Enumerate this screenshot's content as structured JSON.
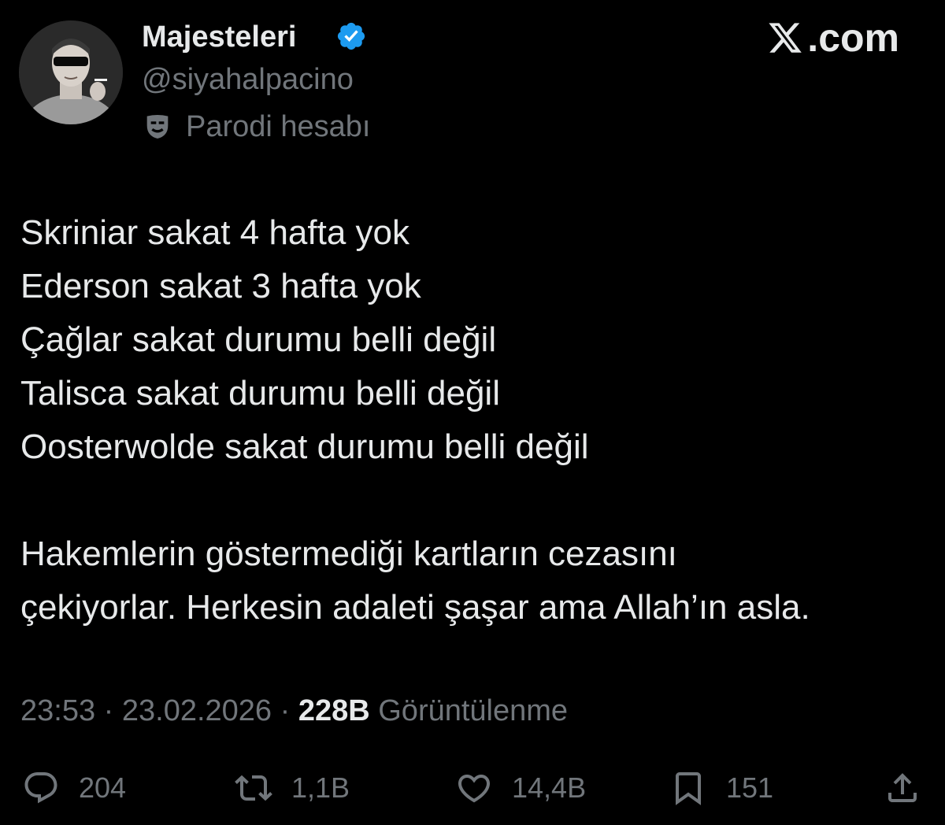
{
  "header": {
    "display_name": "Majesteleri",
    "handle": "@siyahalpacino",
    "parody_label": "Parodi hesabı",
    "brand": ".com",
    "verified_color": "#1d9bf0",
    "icons": {
      "avatar": "profile-avatar",
      "verified": "verified-badge-icon",
      "parody": "parody-mask-icon",
      "brand": "x-logo-icon"
    }
  },
  "tweet": {
    "lines": [
      "Skriniar sakat 4 hafta yok",
      "Ederson sakat 3 hafta yok",
      "Çağlar sakat durumu belli değil",
      "Talisca sakat durumu belli değil",
      "Oosterwolde sakat durumu belli değil"
    ],
    "paragraph2": [
      "Hakemlerin göstermediği kartların cezasını",
      "çekiyorlar. Herkesin adaleti şaşar ama Allah’ın asla."
    ]
  },
  "meta": {
    "time": "23:53",
    "separator": " · ",
    "date": "23.02.2026",
    "views_count": "228B",
    "views_label": "Görüntülenme"
  },
  "actions": {
    "reply": {
      "icon": "reply-icon",
      "count": "204"
    },
    "retweet": {
      "icon": "retweet-icon",
      "count": "1,1B"
    },
    "like": {
      "icon": "heart-icon",
      "count": "14,4B"
    },
    "bookmark": {
      "icon": "bookmark-icon",
      "count": "151"
    },
    "share": {
      "icon": "share-icon"
    }
  },
  "colors": {
    "background": "#000000",
    "primary_text": "#e7e9ea",
    "secondary_text": "#71767b",
    "accent": "#1d9bf0"
  }
}
